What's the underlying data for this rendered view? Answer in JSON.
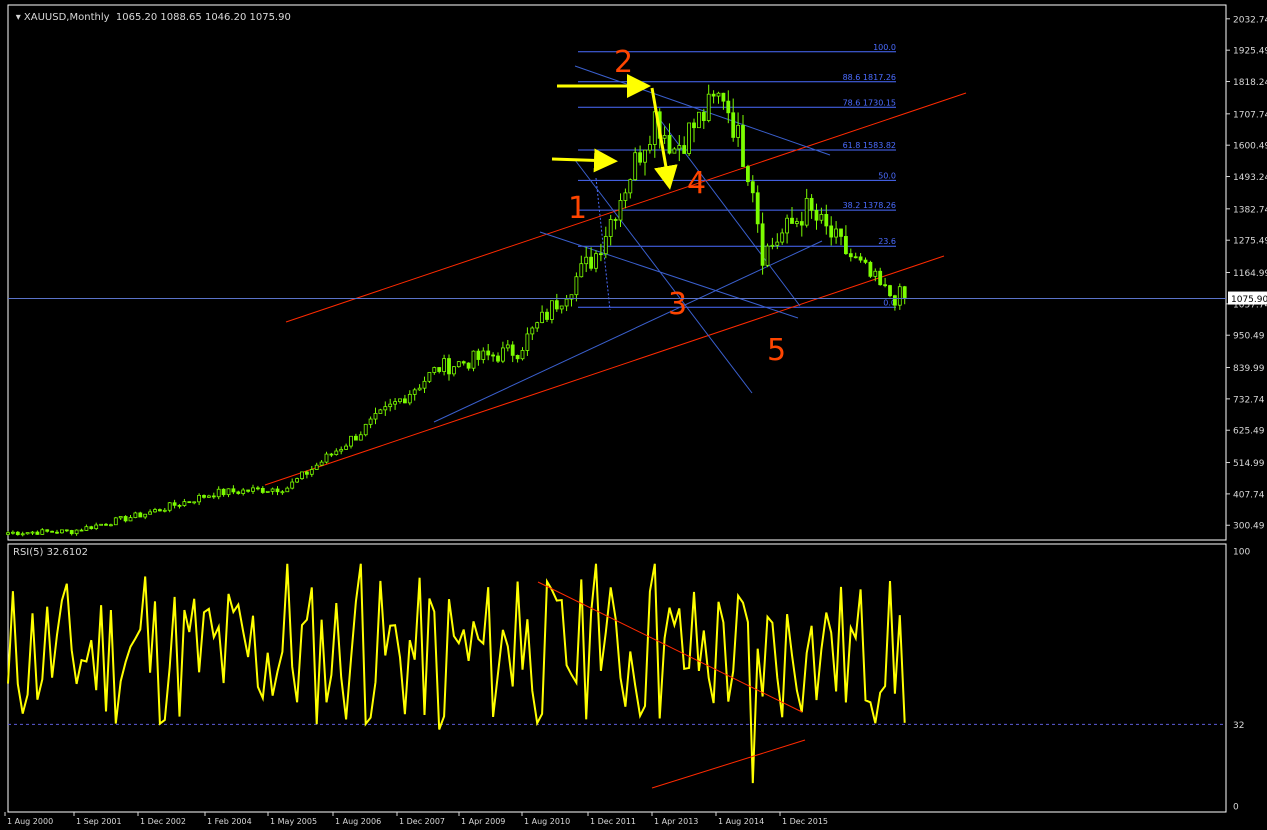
{
  "window": {
    "symbol_title": "XAUUSD,Monthly",
    "ohlc_text": "1065.20 1088.65 1046.20 1075.90"
  },
  "price_axis": {
    "ticks": [
      "2032.74",
      "1925.49",
      "1818.24",
      "1707.74",
      "1600.49",
      "1493.24",
      "1382.74",
      "1275.49",
      "1164.99",
      "1057.74",
      "950.49",
      "839.99",
      "732.74",
      "625.49",
      "514.99",
      "407.74",
      "300.49"
    ],
    "current_price": "1075.90"
  },
  "rsi": {
    "title": "RSI(5) 32.6102",
    "axis_ticks": [
      "100",
      "32",
      "0"
    ],
    "level": 32
  },
  "time_axis": {
    "labels": [
      "1 Aug 2000",
      "1 Sep 2001",
      "1 Dec 2002",
      "1 Feb 2004",
      "1 May 2005",
      "1 Aug 2006",
      "1 Dec 2007",
      "1 Apr 2009",
      "1 Aug 2010",
      "1 Dec 2011",
      "1 Apr 2013",
      "1 Aug 2014",
      "1 Dec 2015"
    ]
  },
  "fibonacci": {
    "levels": [
      {
        "text": "100.0",
        "value": 1920
      },
      {
        "text": "88.6 1817.26",
        "value": 1817.26
      },
      {
        "text": "78.6 1730.15",
        "value": 1730.15
      },
      {
        "text": "61.8 1583.82",
        "value": 1583.82
      },
      {
        "text": "50.0",
        "value": 1480
      },
      {
        "text": "38.2 1378.26",
        "value": 1378.26
      },
      {
        "text": "23.6",
        "value": 1255
      },
      {
        "text": "0.0",
        "value": 1046
      }
    ]
  },
  "wave_labels": [
    "1",
    "2",
    "3",
    "4",
    "5"
  ],
  "colors": {
    "background": "#000000",
    "candles": "#7cfc00",
    "rsi_line": "#ffff00",
    "trend_red": "#ff2a00",
    "trend_blue": "#3a5fcd",
    "fib_blue": "#4b6cff",
    "wave_label": "#ff4500",
    "arrow_yellow": "#ffff00",
    "axis_text": "#d8d8d8"
  },
  "chart_data": [
    {
      "type": "candlestick",
      "series": [
        {
          "name": "XAUUSD,Monthly"
        }
      ],
      "x": [
        "2000-08",
        "2001-09",
        "2002-12",
        "2004-02",
        "2005-05",
        "2006-08",
        "2007-12",
        "2009-04",
        "2010-08",
        "2011-08",
        "2011-12",
        "2012-10",
        "2013-04",
        "2013-06",
        "2014-03",
        "2014-08",
        "2015-07",
        "2015-11"
      ],
      "close": [
        275,
        280,
        340,
        410,
        430,
        620,
        840,
        900,
        1230,
        1700,
        1590,
        1780,
        1470,
        1230,
        1380,
        1290,
        1095,
        1075.9
      ],
      "ylim": [
        250,
        2080
      ],
      "grid": false,
      "last_bar": {
        "open": 1065.2,
        "high": 1088.65,
        "low": 1046.2,
        "close": 1075.9
      }
    },
    {
      "type": "line",
      "series": [
        {
          "name": "RSI(5)"
        }
      ],
      "x": [
        "2000-08",
        "2002-12",
        "2005-05",
        "2006-08",
        "2007-12",
        "2009-04",
        "2010-08",
        "2011-08",
        "2012-10",
        "2013-04",
        "2014-03",
        "2014-08",
        "2015-07",
        "2015-11"
      ],
      "values": [
        48,
        90,
        95,
        95,
        30,
        88,
        95,
        95,
        72,
        9,
        60,
        68,
        47,
        32.61
      ],
      "ylim": [
        0,
        100
      ],
      "levels": [
        32
      ],
      "last_value": 32.6102
    }
  ]
}
